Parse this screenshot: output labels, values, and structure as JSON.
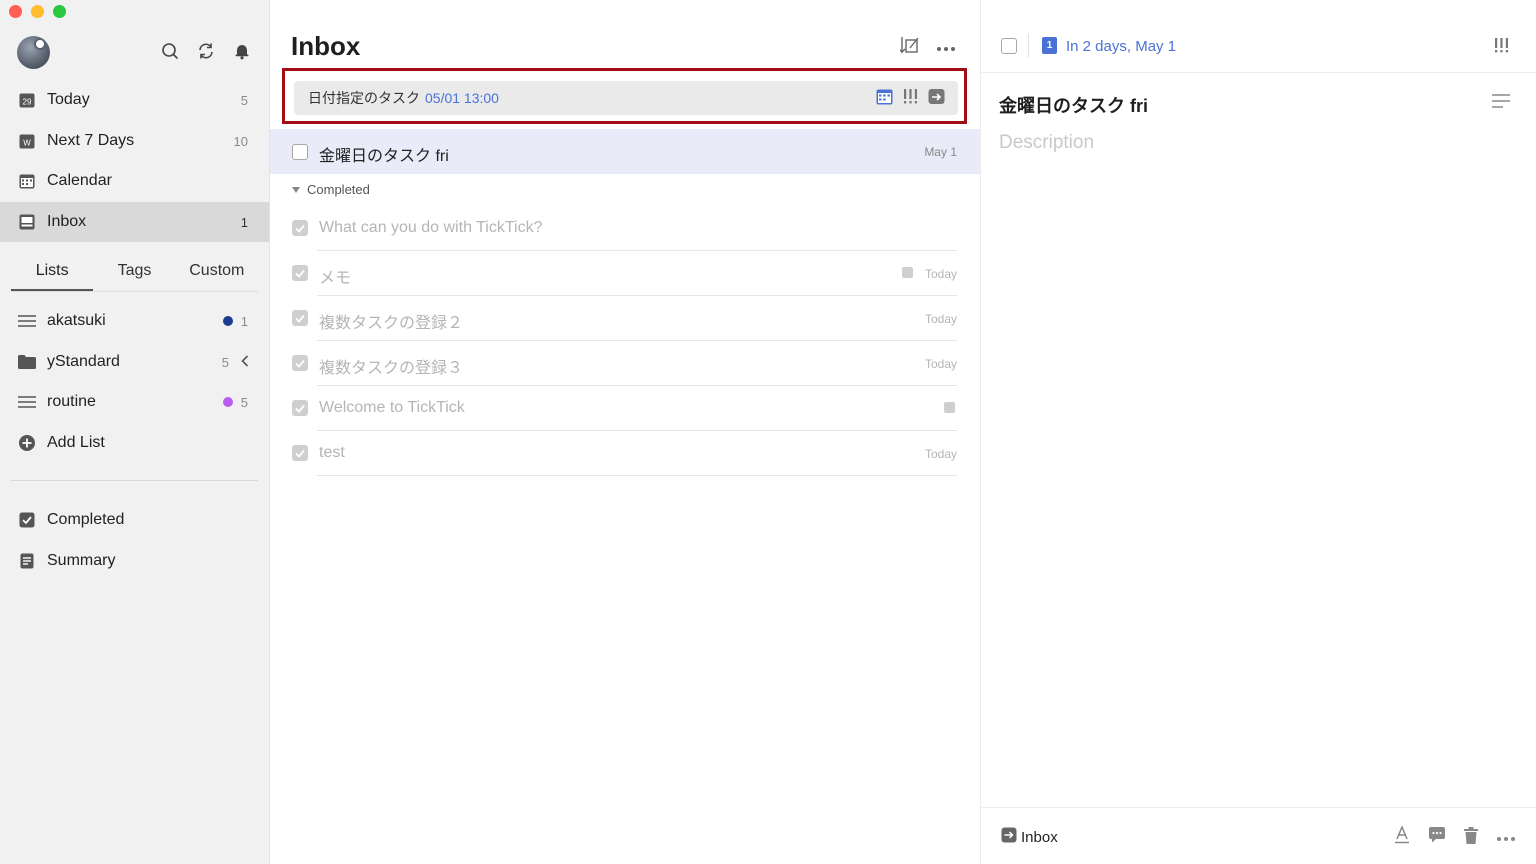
{
  "sidebar": {
    "smart_lists": [
      {
        "label": "Today",
        "count": "5",
        "icon": "calendar-day-icon",
        "day": "29"
      },
      {
        "label": "Next 7 Days",
        "count": "10",
        "icon": "week-icon",
        "letter": "W"
      },
      {
        "label": "Calendar",
        "count": "",
        "icon": "calendar-icon"
      },
      {
        "label": "Inbox",
        "count": "1",
        "icon": "inbox-icon"
      }
    ],
    "tabs": [
      "Lists",
      "Tags",
      "Custom"
    ],
    "active_tab": "Lists",
    "lists": [
      {
        "label": "akatsuki",
        "count": "1",
        "dot_color": "#1f3b8f"
      },
      {
        "label": "yStandard",
        "count": "5",
        "folder": true
      },
      {
        "label": "routine",
        "count": "5",
        "dot_color": "#b95cf0"
      }
    ],
    "add_list_label": "Add List",
    "bottom": [
      {
        "label": "Completed",
        "icon": "checkbox-icon"
      },
      {
        "label": "Summary",
        "icon": "summary-icon"
      }
    ]
  },
  "main": {
    "title": "Inbox",
    "add_task": {
      "text": "日付指定のタスク",
      "date": "05/01 13:00"
    },
    "selected_task": {
      "title": "金曜日のタスク fri",
      "date": "May 1"
    },
    "completed_label": "Completed",
    "completed_tasks": [
      {
        "title": "What can you do with TickTick?",
        "date": "",
        "note": false
      },
      {
        "title": "メモ",
        "date": "Today",
        "note": true
      },
      {
        "title": "複数タスクの登録２",
        "date": "Today",
        "note": false
      },
      {
        "title": "複数タスクの登録３",
        "date": "Today",
        "note": false
      },
      {
        "title": "Welcome to TickTick",
        "date": "",
        "note": true
      },
      {
        "title": "test",
        "date": "Today",
        "note": false
      }
    ]
  },
  "detail": {
    "calendar_day": "1",
    "due": "In 2 days, May 1",
    "title": "金曜日のタスク fri",
    "description_placeholder": "Description",
    "list_name": "Inbox"
  },
  "colors": {
    "accent": "#4a72d6",
    "highlight_frame": "#a30e14",
    "selected_row": "#e9ebf8"
  }
}
